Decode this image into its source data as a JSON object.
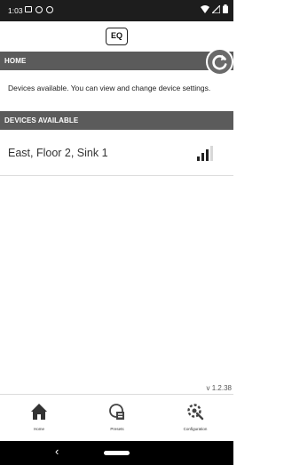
{
  "status_bar": {
    "time": "1:03",
    "icons": [
      "message-icon",
      "instagram-icon",
      "instagram-icon",
      "wifi-icon",
      "signal-icon",
      "battery-icon"
    ]
  },
  "header": {
    "logo_text": "EQ"
  },
  "home": {
    "title": "HOME",
    "description": "Devices available. You can view and change device settings."
  },
  "devices": {
    "title": "DEVICES AVAILABLE",
    "items": [
      {
        "name": "East, Floor 2, Sink 1",
        "signal_level": 0.75
      }
    ]
  },
  "version": "v 1.2.38",
  "nav": {
    "items": [
      {
        "label": "Home",
        "icon": "home-icon"
      },
      {
        "label": "Presets",
        "icon": "presets-icon"
      },
      {
        "label": "Configuration",
        "icon": "configuration-icon"
      }
    ]
  },
  "colors": {
    "section_bar": "#5b5b5b",
    "status_bar": "#1d1d1d",
    "accent": "#222222"
  }
}
